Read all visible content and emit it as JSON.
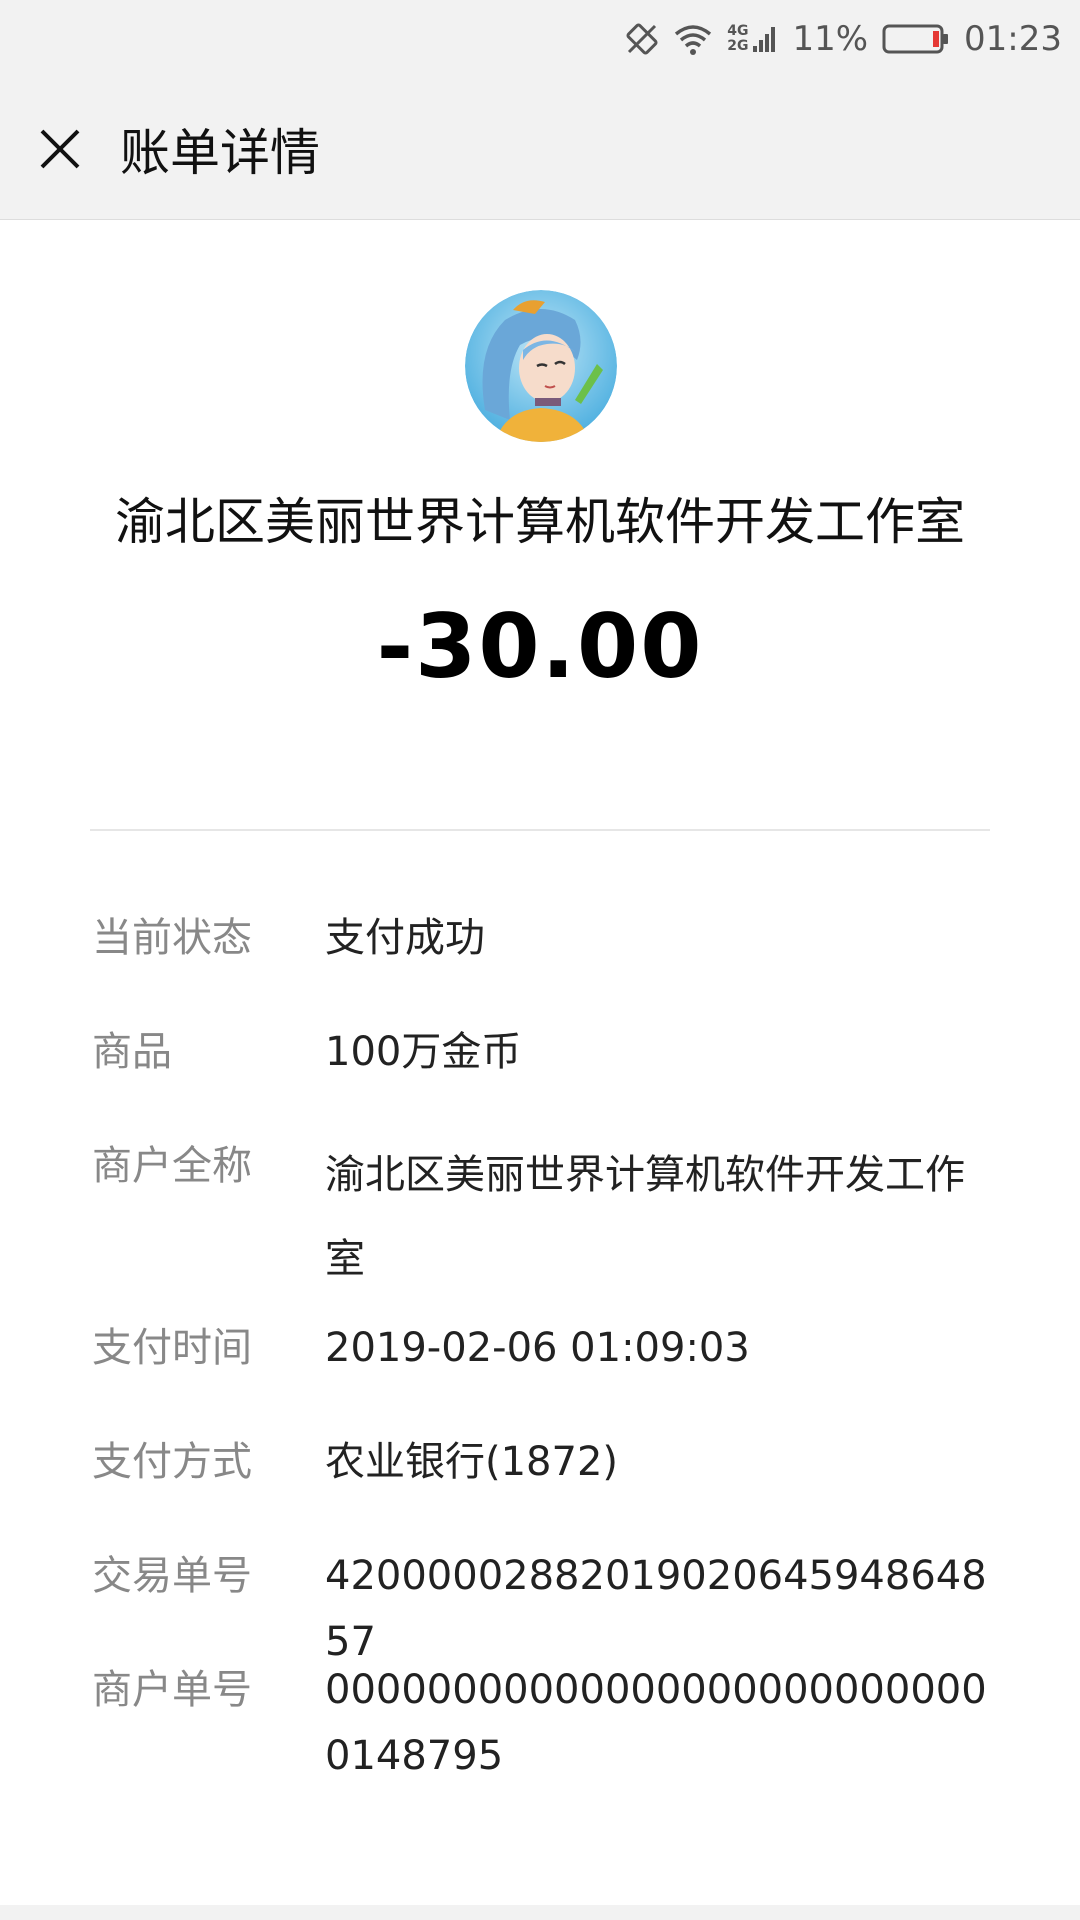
{
  "status_bar": {
    "icons": [
      "screen-rotation-icon",
      "wifi-icon",
      "signal-icon",
      "battery-icon"
    ],
    "network_labels": [
      "4G",
      "2G"
    ],
    "battery_percent": "11%",
    "time": "01:23",
    "battery_level_fraction": 0.11,
    "battery_color": "#e53935"
  },
  "header": {
    "close_icon": "close-icon",
    "title": "账单详情"
  },
  "merchant": {
    "name": "渝北区美丽世界计算机软件开发工作室",
    "amount": "-30.00"
  },
  "details": [
    {
      "label": "当前状态",
      "value": "支付成功"
    },
    {
      "label": "商品",
      "value": "100万金币"
    },
    {
      "label": "商户全称",
      "value": "渝北区美丽世界计算机软件开发工作室"
    },
    {
      "label": "支付时间",
      "value": "2019-02-06 01:09:03"
    },
    {
      "label": "支付方式",
      "value": "农业银行(1872)"
    },
    {
      "label": "交易单号",
      "value": "4200000288201902064594864857"
    },
    {
      "label": "商户单号",
      "value": "000000000000000000000000000148795"
    }
  ]
}
